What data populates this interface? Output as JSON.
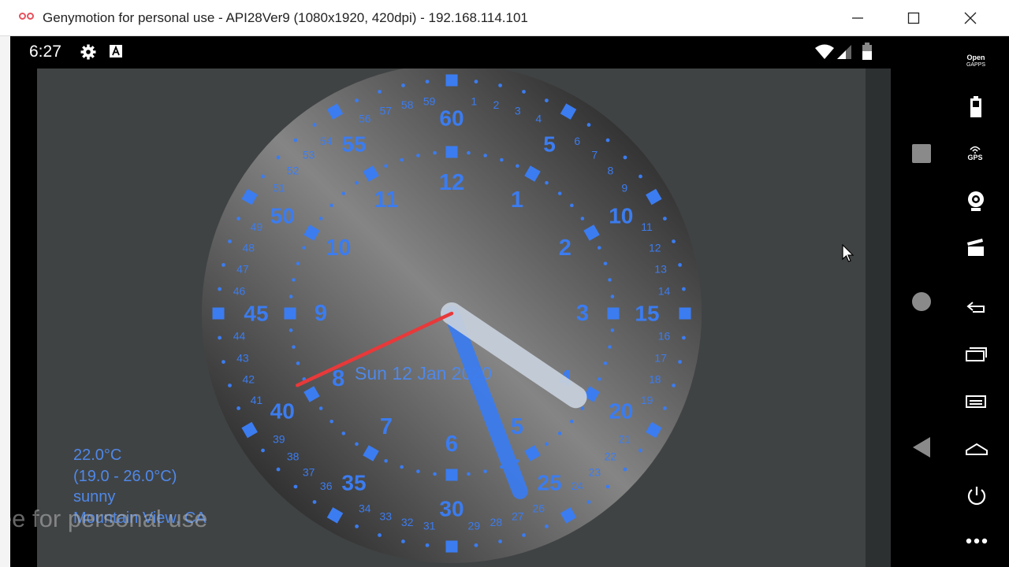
{
  "window": {
    "title": "Genymotion for personal use - API28Ver9 (1080x1920, 420dpi) - 192.168.114.101",
    "controls": [
      "minimize",
      "maximize",
      "close"
    ]
  },
  "statusbar": {
    "time": "6:27",
    "icons": [
      "settings-gear-icon",
      "a-notification-icon",
      "wifi-icon",
      "signal-icon",
      "battery-icon"
    ]
  },
  "clock": {
    "date": "Sun 12 Jan 2020",
    "hour_hand_points_to": 5,
    "minute_hand_points_to": 27,
    "second_hand_points_to": 40,
    "hour_labels": [
      "12",
      "1",
      "2",
      "3",
      "4",
      "5",
      "6",
      "7",
      "8",
      "9",
      "10",
      "11"
    ],
    "minute_outer_labels": [
      "60",
      "5",
      "10",
      "15",
      "20",
      "25",
      "30",
      "35",
      "40",
      "45",
      "50",
      "55"
    ],
    "colors": {
      "accent": "#3b7cf0",
      "second_hand": "#e8393a",
      "hour_hand": "#c8d0dc",
      "face_light": "#8a8a8a",
      "face_dark": "#111111"
    }
  },
  "weather": {
    "temperature": "22.0°C",
    "range": "(19.0 - 26.0°C)",
    "condition": "sunny",
    "location": "Mountain View, CA"
  },
  "watermark": "free for personal use",
  "sidebar": {
    "logo_line1": "Open",
    "logo_line2": "GAPPS",
    "gps_label": "GPS",
    "icons": [
      "opengapps-icon",
      "battery-widget-icon",
      "gps-icon",
      "webcam-icon",
      "media-clapper-icon",
      "back-icon",
      "recent-apps-icon",
      "menu-icon",
      "home-icon",
      "power-icon",
      "more-icon"
    ]
  }
}
